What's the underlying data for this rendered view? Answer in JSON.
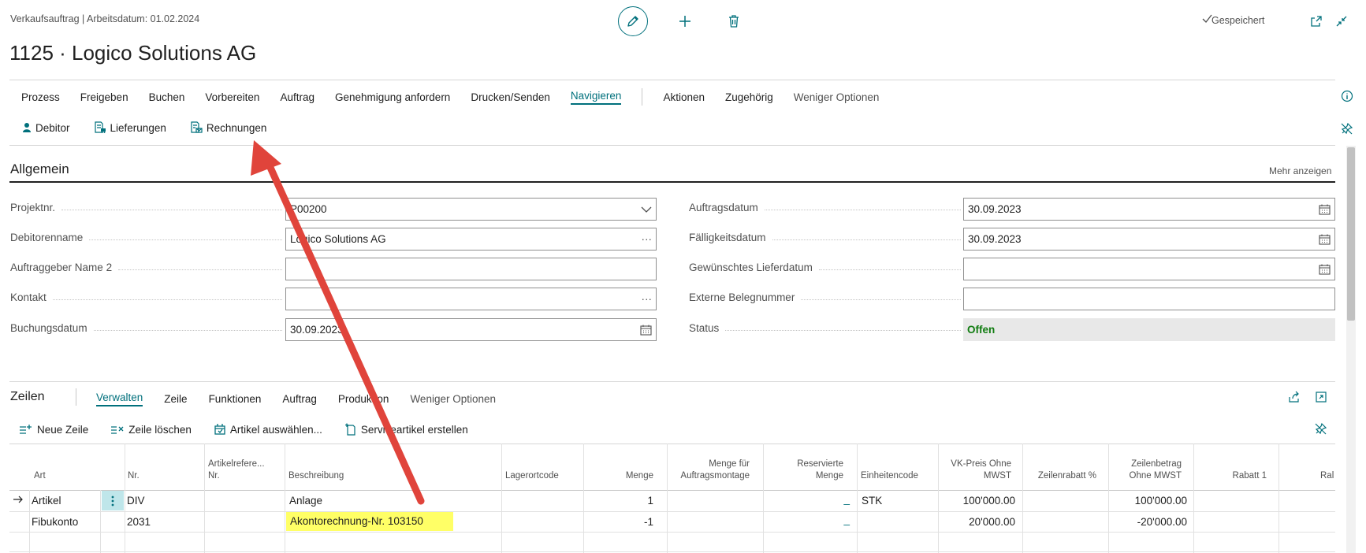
{
  "header": {
    "breadcrumb": "Verkaufsauftrag | Arbeitsdatum: 01.02.2024",
    "title": "1125 · Logico Solutions AG",
    "saved_status": "Gespeichert"
  },
  "action_bar": {
    "items": [
      "Prozess",
      "Freigeben",
      "Buchen",
      "Vorbereiten",
      "Auftrag",
      "Genehmigung anfordern",
      "Drucken/Senden",
      "Navigieren"
    ],
    "active": "Navigieren",
    "items_after": [
      "Aktionen",
      "Zugehörig",
      "Weniger Optionen"
    ],
    "sub_items": [
      "Debitor",
      "Lieferungen",
      "Rechnungen"
    ]
  },
  "general": {
    "title": "Allgemein",
    "show_more": "Mehr anzeigen",
    "left_fields": [
      {
        "label": "Projektnr.",
        "value": "P00200",
        "icon": "chevron-down-icon"
      },
      {
        "label": "Debitorenname",
        "value": "Logico Solutions AG",
        "icon": "ellipsis-icon"
      },
      {
        "label": "Auftraggeber Name 2",
        "value": "",
        "icon": ""
      },
      {
        "label": "Kontakt",
        "value": "",
        "icon": "ellipsis-icon"
      },
      {
        "label": "Buchungsdatum",
        "value": "30.09.2023",
        "icon": "calendar-icon"
      }
    ],
    "right_fields": [
      {
        "label": "Auftragsdatum",
        "value": "30.09.2023",
        "icon": "calendar-icon"
      },
      {
        "label": "Fälligkeitsdatum",
        "value": "30.09.2023",
        "icon": "calendar-icon"
      },
      {
        "label": "Gewünschtes Lieferdatum",
        "value": "",
        "icon": "calendar-icon"
      },
      {
        "label": "Externe Belegnummer",
        "value": "",
        "icon": ""
      },
      {
        "label": "Status",
        "value": "Offen",
        "icon": ""
      }
    ]
  },
  "lines": {
    "title": "Zeilen",
    "menu": [
      "Verwalten",
      "Zeile",
      "Funktionen",
      "Auftrag",
      "Produktion",
      "Weniger Optionen"
    ],
    "active_menu": "Verwalten",
    "tools": [
      "Neue Zeile",
      "Zeile löschen",
      "Artikel auswählen...",
      "Serviceartikel erstellen"
    ],
    "columns": {
      "art": "Art",
      "nr": "Nr.",
      "artref": [
        "Artikelrefere...",
        "Nr."
      ],
      "beschreibung": "Beschreibung",
      "lagerort": "Lagerortcode",
      "menge": "Menge",
      "montage": [
        "Menge für",
        "Auftragsmontage"
      ],
      "reserviert": [
        "Reservierte",
        "Menge"
      ],
      "einheit": "Einheitencode",
      "vkpreis": [
        "VK-Preis Ohne",
        "MWST"
      ],
      "zeilenrabatt": "Zeilenrabatt %",
      "zeilenbetrag": [
        "Zeilenbetrag",
        "Ohne MWST"
      ],
      "rabatt1": "Rabatt 1",
      "rabatt_cut": "Ral"
    },
    "rows": [
      {
        "art": "Artikel",
        "nr": "DIV",
        "beschreibung": "Anlage",
        "menge": "1",
        "reserviert": "_",
        "einheit": "STK",
        "vkpreis": "100'000.00",
        "zeilenbetrag": "100'000.00"
      },
      {
        "art": "Fibukonto",
        "nr": "2031",
        "beschreibung": "Akontorechnung-Nr. 103150",
        "menge": "-1",
        "reserviert": "_",
        "einheit": "",
        "vkpreis": "20'000.00",
        "zeilenbetrag": "-20'000.00"
      }
    ]
  },
  "colors": {
    "accent": "#00707c",
    "annotation_arrow": "#e0443b",
    "highlight": "#ffff66",
    "status_green": "#107c10"
  }
}
